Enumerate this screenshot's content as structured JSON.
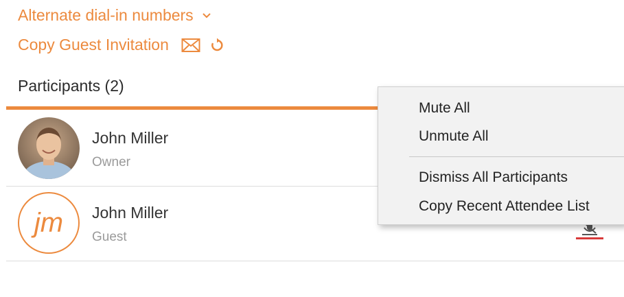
{
  "links": {
    "alternate_dialin": "Alternate dial-in numbers",
    "copy_guest_invitation": "Copy Guest Invitation"
  },
  "participants": {
    "heading": "Participants (2)",
    "items": [
      {
        "name": "John Miller",
        "role": "Owner",
        "avatar": "photo"
      },
      {
        "name": "John Miller",
        "role": "Guest",
        "avatar": "initials",
        "initials": "jm"
      }
    ]
  },
  "context_menu": {
    "items": [
      "Mute All",
      "Unmute All",
      "Dismiss All Participants",
      "Copy Recent Attendee List"
    ]
  },
  "colors": {
    "accent": "#ec8a3e",
    "muted_indicator": "#d83a3a"
  },
  "icons": [
    "chevron-down-icon",
    "mail-icon",
    "refresh-icon",
    "muted-mic-icon"
  ]
}
